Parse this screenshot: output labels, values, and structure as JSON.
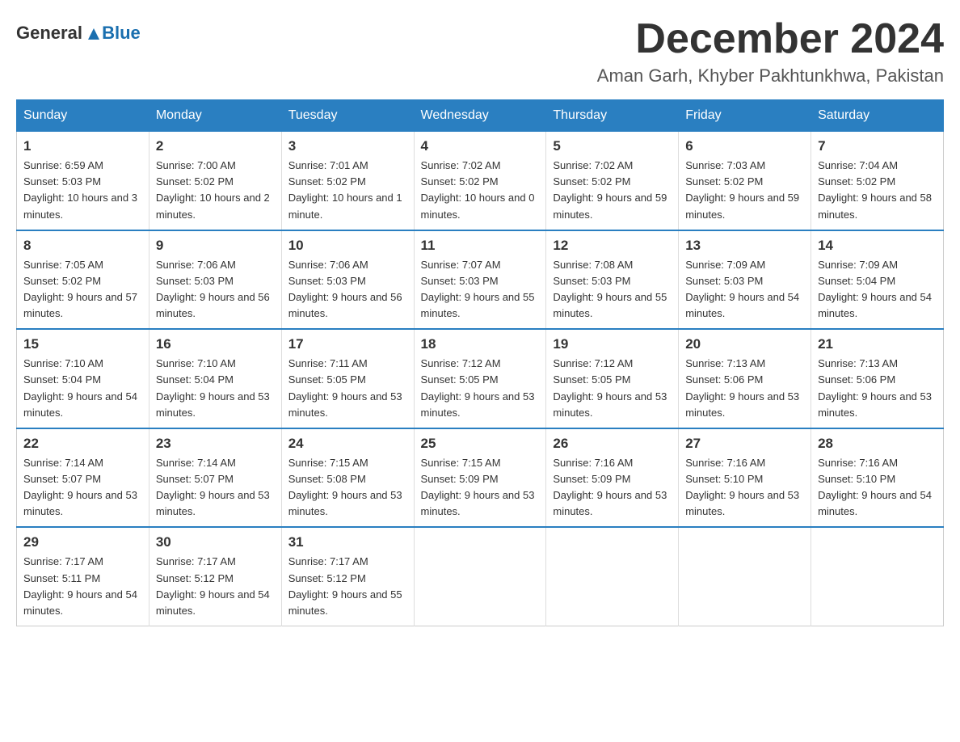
{
  "header": {
    "logo_text_general": "General",
    "logo_text_blue": "Blue",
    "month_title": "December 2024",
    "location": "Aman Garh, Khyber Pakhtunkhwa, Pakistan"
  },
  "days_of_week": [
    "Sunday",
    "Monday",
    "Tuesday",
    "Wednesday",
    "Thursday",
    "Friday",
    "Saturday"
  ],
  "weeks": [
    [
      {
        "day": "1",
        "sunrise": "6:59 AM",
        "sunset": "5:03 PM",
        "daylight": "10 hours and 3 minutes."
      },
      {
        "day": "2",
        "sunrise": "7:00 AM",
        "sunset": "5:02 PM",
        "daylight": "10 hours and 2 minutes."
      },
      {
        "day": "3",
        "sunrise": "7:01 AM",
        "sunset": "5:02 PM",
        "daylight": "10 hours and 1 minute."
      },
      {
        "day": "4",
        "sunrise": "7:02 AM",
        "sunset": "5:02 PM",
        "daylight": "10 hours and 0 minutes."
      },
      {
        "day": "5",
        "sunrise": "7:02 AM",
        "sunset": "5:02 PM",
        "daylight": "9 hours and 59 minutes."
      },
      {
        "day": "6",
        "sunrise": "7:03 AM",
        "sunset": "5:02 PM",
        "daylight": "9 hours and 59 minutes."
      },
      {
        "day": "7",
        "sunrise": "7:04 AM",
        "sunset": "5:02 PM",
        "daylight": "9 hours and 58 minutes."
      }
    ],
    [
      {
        "day": "8",
        "sunrise": "7:05 AM",
        "sunset": "5:02 PM",
        "daylight": "9 hours and 57 minutes."
      },
      {
        "day": "9",
        "sunrise": "7:06 AM",
        "sunset": "5:03 PM",
        "daylight": "9 hours and 56 minutes."
      },
      {
        "day": "10",
        "sunrise": "7:06 AM",
        "sunset": "5:03 PM",
        "daylight": "9 hours and 56 minutes."
      },
      {
        "day": "11",
        "sunrise": "7:07 AM",
        "sunset": "5:03 PM",
        "daylight": "9 hours and 55 minutes."
      },
      {
        "day": "12",
        "sunrise": "7:08 AM",
        "sunset": "5:03 PM",
        "daylight": "9 hours and 55 minutes."
      },
      {
        "day": "13",
        "sunrise": "7:09 AM",
        "sunset": "5:03 PM",
        "daylight": "9 hours and 54 minutes."
      },
      {
        "day": "14",
        "sunrise": "7:09 AM",
        "sunset": "5:04 PM",
        "daylight": "9 hours and 54 minutes."
      }
    ],
    [
      {
        "day": "15",
        "sunrise": "7:10 AM",
        "sunset": "5:04 PM",
        "daylight": "9 hours and 54 minutes."
      },
      {
        "day": "16",
        "sunrise": "7:10 AM",
        "sunset": "5:04 PM",
        "daylight": "9 hours and 53 minutes."
      },
      {
        "day": "17",
        "sunrise": "7:11 AM",
        "sunset": "5:05 PM",
        "daylight": "9 hours and 53 minutes."
      },
      {
        "day": "18",
        "sunrise": "7:12 AM",
        "sunset": "5:05 PM",
        "daylight": "9 hours and 53 minutes."
      },
      {
        "day": "19",
        "sunrise": "7:12 AM",
        "sunset": "5:05 PM",
        "daylight": "9 hours and 53 minutes."
      },
      {
        "day": "20",
        "sunrise": "7:13 AM",
        "sunset": "5:06 PM",
        "daylight": "9 hours and 53 minutes."
      },
      {
        "day": "21",
        "sunrise": "7:13 AM",
        "sunset": "5:06 PM",
        "daylight": "9 hours and 53 minutes."
      }
    ],
    [
      {
        "day": "22",
        "sunrise": "7:14 AM",
        "sunset": "5:07 PM",
        "daylight": "9 hours and 53 minutes."
      },
      {
        "day": "23",
        "sunrise": "7:14 AM",
        "sunset": "5:07 PM",
        "daylight": "9 hours and 53 minutes."
      },
      {
        "day": "24",
        "sunrise": "7:15 AM",
        "sunset": "5:08 PM",
        "daylight": "9 hours and 53 minutes."
      },
      {
        "day": "25",
        "sunrise": "7:15 AM",
        "sunset": "5:09 PM",
        "daylight": "9 hours and 53 minutes."
      },
      {
        "day": "26",
        "sunrise": "7:16 AM",
        "sunset": "5:09 PM",
        "daylight": "9 hours and 53 minutes."
      },
      {
        "day": "27",
        "sunrise": "7:16 AM",
        "sunset": "5:10 PM",
        "daylight": "9 hours and 53 minutes."
      },
      {
        "day": "28",
        "sunrise": "7:16 AM",
        "sunset": "5:10 PM",
        "daylight": "9 hours and 54 minutes."
      }
    ],
    [
      {
        "day": "29",
        "sunrise": "7:17 AM",
        "sunset": "5:11 PM",
        "daylight": "9 hours and 54 minutes."
      },
      {
        "day": "30",
        "sunrise": "7:17 AM",
        "sunset": "5:12 PM",
        "daylight": "9 hours and 54 minutes."
      },
      {
        "day": "31",
        "sunrise": "7:17 AM",
        "sunset": "5:12 PM",
        "daylight": "9 hours and 55 minutes."
      },
      null,
      null,
      null,
      null
    ]
  ],
  "labels": {
    "sunrise_prefix": "Sunrise: ",
    "sunset_prefix": "Sunset: ",
    "daylight_prefix": "Daylight: "
  }
}
